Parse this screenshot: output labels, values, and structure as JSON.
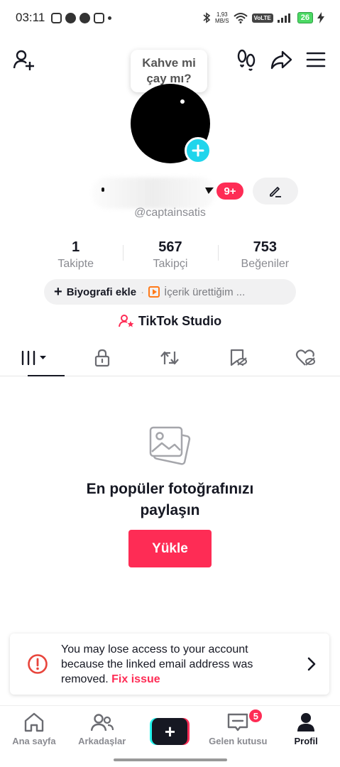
{
  "status_bar": {
    "time": "03:11",
    "net_speed_value": "1,93",
    "net_speed_unit": "MB/S",
    "volte": "VoLTE",
    "battery": "26"
  },
  "bubble": {
    "text_line1": "Kahve mi",
    "text_line2": "çay mı?"
  },
  "profile": {
    "notification_count": "9+",
    "username": "@captainsatis"
  },
  "stats": [
    {
      "value": "1",
      "label": "Takipte"
    },
    {
      "value": "567",
      "label": "Takipçi"
    },
    {
      "value": "753",
      "label": "Beğeniler"
    }
  ],
  "bio": {
    "add_label": "Biyografi ekle",
    "separator": "·",
    "content_label": "İçerik ürettiğim ..."
  },
  "studio": {
    "label": "TikTok Studio"
  },
  "empty_state": {
    "title_line1": "En popüler fotoğrafınızı",
    "title_line2": "paylaşın",
    "upload_label": "Yükle"
  },
  "warning": {
    "message": "You may lose access to your account because the linked email address was removed.",
    "fix_label": "Fix issue"
  },
  "bottom_nav": {
    "home": "Ana sayfa",
    "friends": "Arkadaşlar",
    "create": "+",
    "inbox": "Gelen kutusu",
    "inbox_badge": "5",
    "profile": "Profil"
  },
  "colors": {
    "accent": "#fe2c55",
    "cyan": "#25f4ee",
    "text": "#161823",
    "muted": "#8a8b91"
  }
}
